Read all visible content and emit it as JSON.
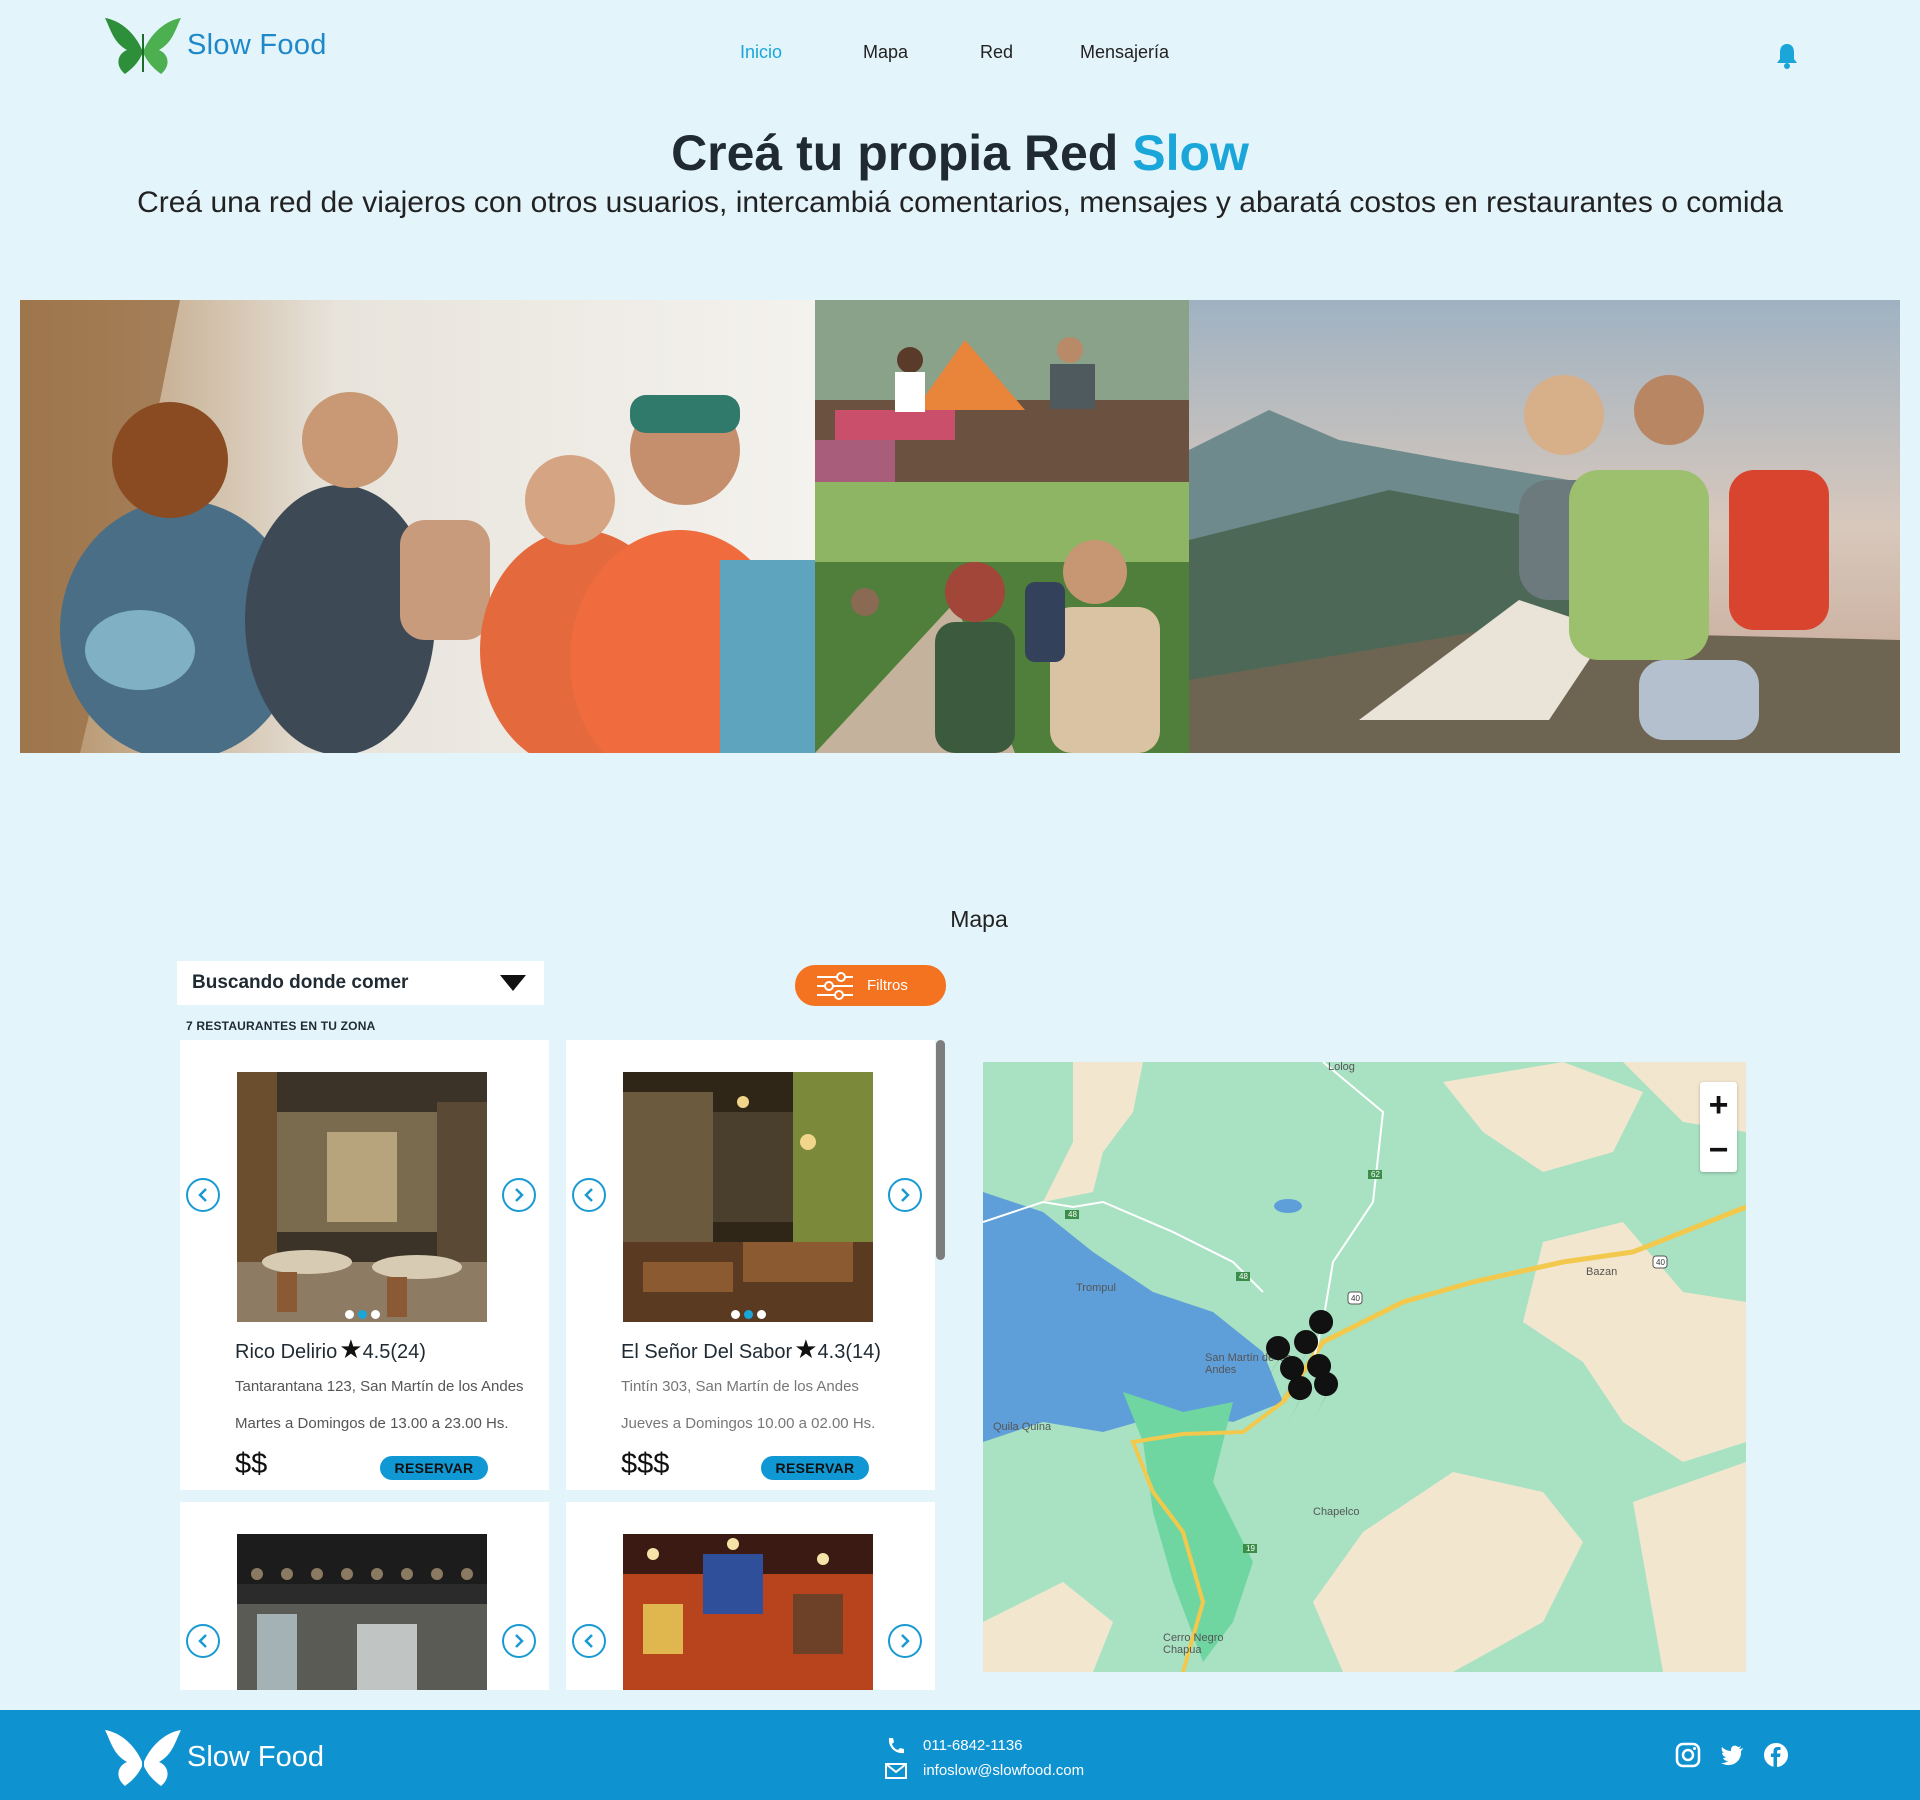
{
  "brand": {
    "name": "Slow Food"
  },
  "nav": {
    "items": [
      "Inicio",
      "Mapa",
      "Red",
      "Mensajería"
    ],
    "active": "Inicio"
  },
  "hero": {
    "title_main": "Creá tu propia Red ",
    "title_accent": "Slow",
    "subtitle": "Creá una red de viajeros con otros usuarios, intercambiá comentarios, mensajes y abaratá costos en restaurantes o comida"
  },
  "map_section": {
    "title": "Mapa",
    "dropdown_value": "Buscando donde comer",
    "filters_label": "Filtros",
    "count_label": "7 RESTAURANTES EN TU ZONA"
  },
  "restaurants": [
    {
      "name": "Rico Delirio",
      "rating": "4.5(24)",
      "address": "Tantarantana 123, San Martín de los Andes",
      "hours": "Martes a Domingos de 13.00 a 23.00 Hs.",
      "price": "$$",
      "cta": "RESERVAR"
    },
    {
      "name": "El Señor Del Sabor",
      "rating": "4.3(14)",
      "address": "Tintín 303, San Martín de los Andes",
      "hours": "Jueves a Domingos 10.00 a 02.00 Hs.",
      "price": "$$$",
      "cta": "RESERVAR"
    }
  ],
  "map": {
    "places": [
      "Lolog",
      "Trompul",
      "Bazan",
      "San Martín de los Andes",
      "Quila Quina",
      "Chapelco",
      "Cerro Negro Chapua"
    ],
    "routes": [
      "62",
      "48",
      "48",
      "40",
      "40",
      "19"
    ],
    "zoom_in": "+",
    "zoom_out": "−"
  },
  "footer": {
    "phone": "011-6842-1136",
    "email": "infoslow@slowfood.com"
  },
  "colors": {
    "accent": "#1aa6d8",
    "orange": "#f47321",
    "footer": "#0f92d0",
    "background": "#e4f4fb"
  },
  "icons": [
    "butterfly-logo-icon",
    "bell-icon",
    "chevron-down-icon",
    "sliders-icon",
    "chevron-left-icon",
    "chevron-right-icon",
    "map-pin-icon",
    "phone-icon",
    "mail-icon",
    "instagram-icon",
    "twitter-icon",
    "facebook-icon"
  ]
}
